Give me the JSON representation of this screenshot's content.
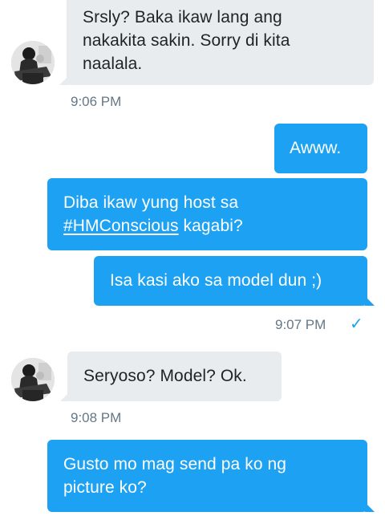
{
  "conversation": {
    "messages": [
      {
        "direction": "incoming",
        "text": "Srsly? Baka ikaw lang ang\nnakakita sakin. Sorry di kita\nnaalala."
      },
      {
        "direction": "outgoing",
        "text": "Awww."
      },
      {
        "direction": "outgoing",
        "text_before": "Diba ikaw yung host sa\n",
        "hashtag": "#HMConscious",
        "text_after": " kagabi?"
      },
      {
        "direction": "outgoing",
        "text": "Isa kasi ako sa model dun ;)"
      },
      {
        "direction": "incoming",
        "text": "Seryoso? Model? Ok."
      },
      {
        "direction": "outgoing",
        "text": "Gusto mo mag send pa ko ng\npicture ko?"
      }
    ],
    "timestamps": [
      "9:06 PM",
      "9:07 PM",
      "9:08 PM"
    ],
    "read_receipt_icon": "check-icon",
    "read_receipt_glyph": "✓"
  },
  "colors": {
    "outgoing_bubble": "#1da1f2",
    "incoming_bubble": "#e9ecee",
    "timestamp": "#657786",
    "read_check": "#1da1f2"
  }
}
